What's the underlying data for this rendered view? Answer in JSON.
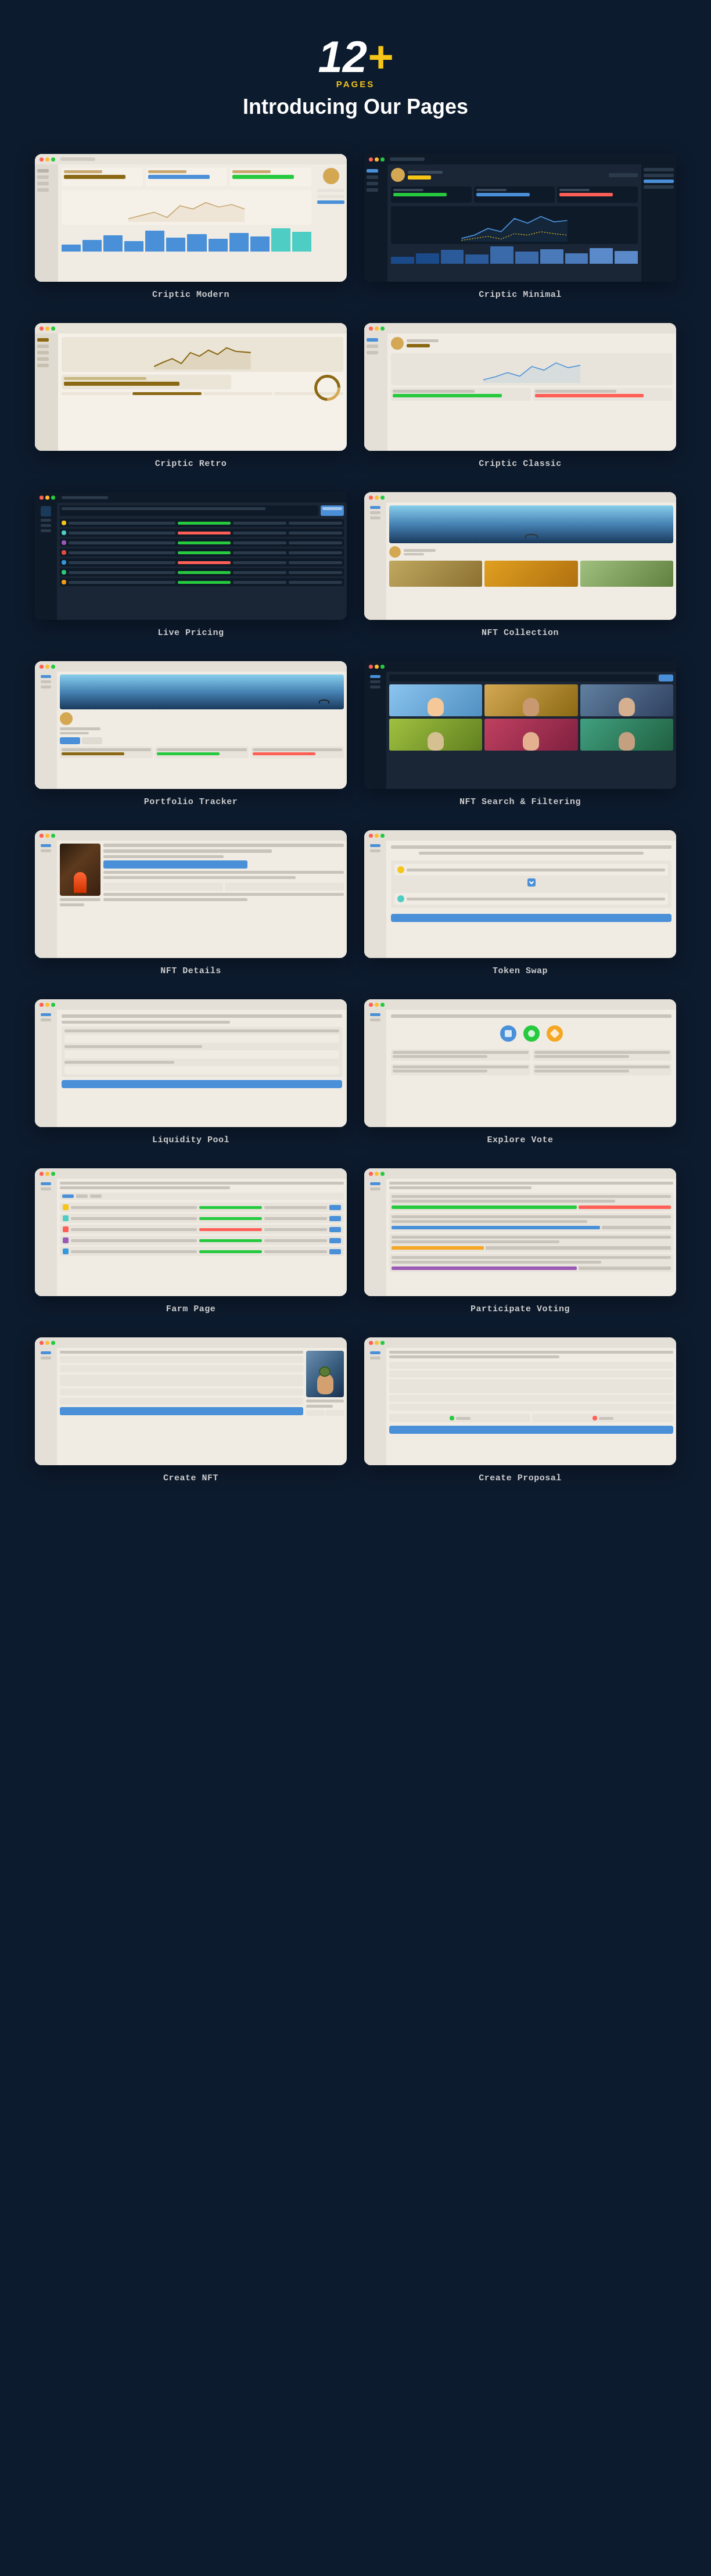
{
  "header": {
    "number": "12",
    "plus": "+",
    "pages_label": "Pages",
    "title": "Introducing Our Pages"
  },
  "cards": [
    {
      "id": "criptic-modern",
      "label": "Criptic Modern"
    },
    {
      "id": "criptic-minimal",
      "label": "Criptic Minimal"
    },
    {
      "id": "criptic-retro",
      "label": "Criptic Retro"
    },
    {
      "id": "criptic-classic",
      "label": "Criptic Classic"
    },
    {
      "id": "live-pricing",
      "label": "Live Pricing"
    },
    {
      "id": "nft-collection",
      "label": "NFT Collection"
    },
    {
      "id": "portfolio-tracker",
      "label": "Portfolio Tracker"
    },
    {
      "id": "nft-search-filtering",
      "label": "NFT Search & Filtering"
    },
    {
      "id": "nft-details",
      "label": "NFT Details"
    },
    {
      "id": "token-swap",
      "label": "Token Swap"
    },
    {
      "id": "liquidity-pool",
      "label": "Liquidity Pool"
    },
    {
      "id": "explore-vote",
      "label": "Explore Vote"
    },
    {
      "id": "farm-page",
      "label": "Farm Page"
    },
    {
      "id": "participate-voting",
      "label": "Participate Voting"
    },
    {
      "id": "create-nft",
      "label": "Create NFT"
    },
    {
      "id": "create-proposal",
      "label": "Create Proposal"
    }
  ]
}
